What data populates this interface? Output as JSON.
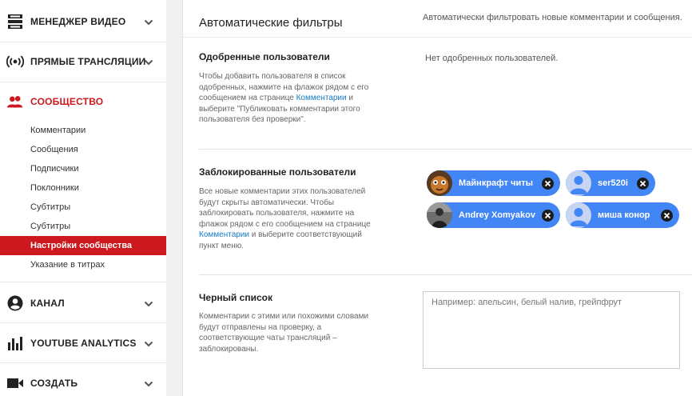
{
  "sidebar": {
    "sections": [
      {
        "id": "video-manager",
        "label": "МЕНЕДЖЕР ВИДЕО",
        "icon": "video-manager-icon"
      },
      {
        "id": "live",
        "label": "ПРЯМЫЕ ТРАНСЛЯЦИИ",
        "icon": "live-broadcast-icon"
      },
      {
        "id": "community",
        "label": "СООБЩЕСТВО",
        "icon": "community-icon",
        "active": true
      },
      {
        "id": "channel",
        "label": "КАНАЛ",
        "icon": "channel-icon"
      },
      {
        "id": "analytics",
        "label": "YOUTUBE ANALYTICS",
        "icon": "analytics-icon"
      },
      {
        "id": "create",
        "label": "СОЗДАТЬ",
        "icon": "create-icon"
      }
    ],
    "community_items": [
      {
        "label": "Комментарии"
      },
      {
        "label": "Сообщения"
      },
      {
        "label": "Подписчики"
      },
      {
        "label": "Поклонники"
      },
      {
        "label": "Субтитры"
      },
      {
        "label": "Субтитры"
      },
      {
        "label": "Настройки сообщества",
        "active": true
      },
      {
        "label": "Указание в титрах"
      }
    ]
  },
  "main": {
    "title": "Автоматические фильтры",
    "description": "Автоматически фильтровать новые комментарии и сообщения.",
    "approved": {
      "title": "Одобренные пользователи",
      "desc_before": "Чтобы добавить пользователя в список одобренных, нажмите на флажок рядом с его сообщением на странице ",
      "link": "Комментарии",
      "desc_after": " и выберите \"Публиковать комментарии этого пользователя без проверки\".",
      "empty": "Нет одобренных пользователей."
    },
    "blocked": {
      "title": "Заблокированные пользователи",
      "desc_before": "Все новые комментарии этих пользователей будут скрыты автоматически. Чтобы заблокировать пользователя, нажмите на флажок рядом с его сообщением на странице ",
      "link": "Комментарии",
      "desc_after": " и выберите соответствующий пункт меню.",
      "users": [
        {
          "name": "Майнкрафт читы",
          "avatar": "photo"
        },
        {
          "name": "ser520i",
          "avatar": "default"
        },
        {
          "name": "Andrey Xomyakov",
          "avatar": "photo"
        },
        {
          "name": "миша конор",
          "avatar": "default"
        }
      ]
    },
    "blacklist": {
      "title": "Черный список",
      "desc": "Комментарии с этими или похожими словами будут отправлены на проверку, а соответствующие чаты трансляций – заблокированы.",
      "placeholder": "Например: апельсин, белый налив, грейпфрут"
    }
  },
  "colors": {
    "accent_red": "#cc181e",
    "chip_blue": "#4285f4",
    "link_blue": "#167ac6"
  }
}
